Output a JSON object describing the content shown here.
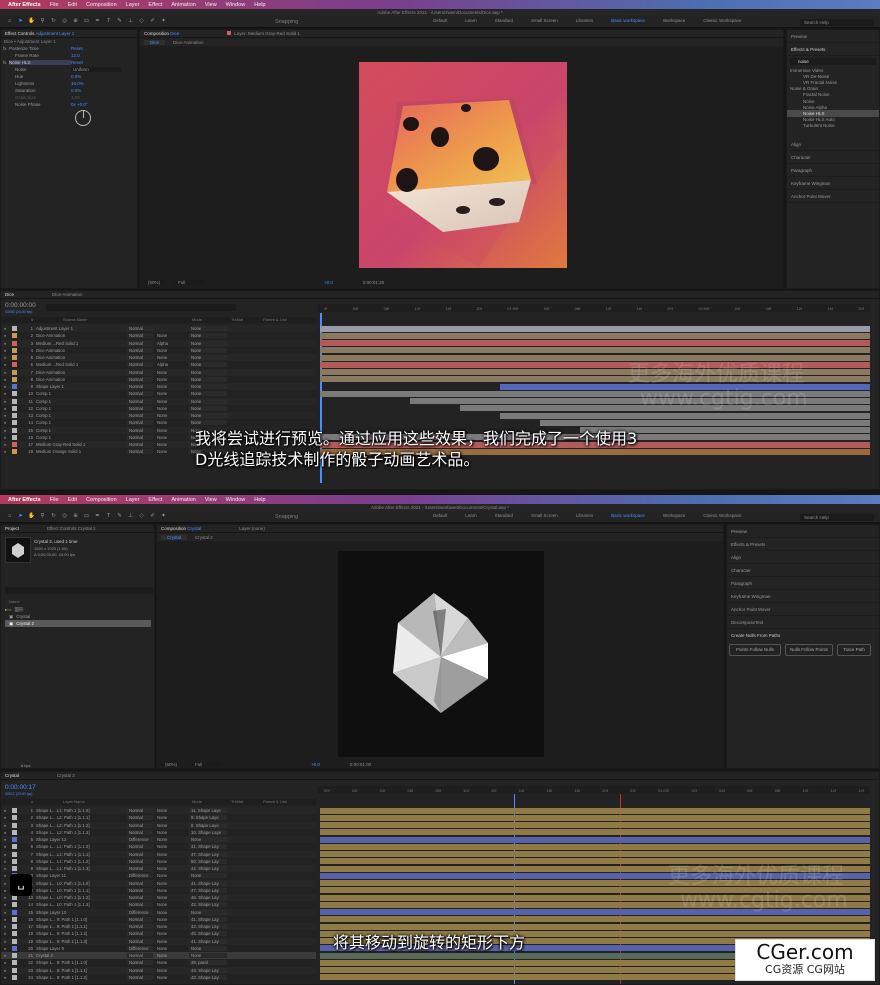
{
  "top": {
    "menu": {
      "app": "After Effects",
      "items": [
        "File",
        "Edit",
        "Composition",
        "Layer",
        "Effect",
        "Animation",
        "View",
        "Window",
        "Help"
      ]
    },
    "window_title": "Adobe After Effects 2021 - /Users/zwein/Documents/Dice.aep *",
    "snapping": "Snapping",
    "workspaces": [
      "Default",
      "Learn",
      "Standard",
      "Small Screen",
      "Libraries",
      "Basic workspace",
      "Workspace",
      "Classic Workspace"
    ],
    "search_placeholder": "Search Help",
    "effect_controls": {
      "tab": "Effect Controls",
      "tab_layer": "Adjustment Layer 1",
      "header": "Dice • Adjustment Layer 1",
      "props": [
        {
          "name": "Posterize Time",
          "value": "Reset"
        },
        {
          "name": "Frame Rate",
          "value": "12.0"
        },
        {
          "name": "Noise HLS",
          "value": "Reset"
        },
        {
          "name": "Noise",
          "value": "Uniform"
        },
        {
          "name": "Hue",
          "value": "0.0%"
        },
        {
          "name": "Lightness",
          "value": "10.0%"
        },
        {
          "name": "Saturation",
          "value": "0.0%"
        },
        {
          "name": "Grain Size",
          "value": "1.00"
        },
        {
          "name": "Noise Phase",
          "value": "0x +0.0°"
        }
      ]
    },
    "comp_panel": {
      "tab": "Composition",
      "tab_comp": "Dice",
      "layer_tab": "Layer: Medium Gray-Red Solid 1",
      "crumbs": [
        "Dice",
        "Dice-Animation"
      ],
      "zoom": "(50%)",
      "quality": "Full",
      "timecode": "0:00:01:20",
      "exposure": "+0.0"
    },
    "right_panel": {
      "preview": "Preview",
      "effects_presets": "Effects & Presets",
      "search_value": "noise",
      "tree": [
        {
          "label": "Immersive Video",
          "indent": 0
        },
        {
          "label": "VR De-Noise",
          "indent": 1
        },
        {
          "label": "VR Fractal Noise",
          "indent": 1
        },
        {
          "label": "Noise & Grain",
          "indent": 0
        },
        {
          "label": "Fractal Noise",
          "indent": 1
        },
        {
          "label": "Noise",
          "indent": 1
        },
        {
          "label": "Noise Alpha",
          "indent": 1
        },
        {
          "label": "Noise HLS",
          "indent": 1,
          "selected": true
        },
        {
          "label": "Noise HLS Auto",
          "indent": 1
        },
        {
          "label": "Turbulent Noise",
          "indent": 1
        }
      ],
      "panels": [
        "Align",
        "Character",
        "Paragraph",
        "Keyframe Wingman",
        "Anchor Point Mover"
      ]
    },
    "timeline": {
      "tabs": [
        "Dice",
        "Dice-Animation"
      ],
      "timecode": "0:00:00:00",
      "fps": "00000 (24.00 fps)",
      "headers": [
        "#",
        "Source Name",
        "Mode",
        "TrkMat",
        "Parent & Link"
      ],
      "ruler": [
        "0f",
        "04f",
        "08f",
        "12f",
        "16f",
        "20f",
        "01:00f",
        "04f",
        "08f",
        "12f",
        "16f",
        "20f",
        "02:00f",
        "04f",
        "08f",
        "12f",
        "16f",
        "20f"
      ],
      "layers": [
        {
          "num": "1",
          "name": "Adjustment Layer 1",
          "color": "#b6b6b6",
          "mode": "Normal",
          "trk": "",
          "parent": "None"
        },
        {
          "num": "2",
          "name": "Dice-Animation",
          "color": "#c59a5a",
          "mode": "Normal",
          "trk": "None",
          "parent": "None"
        },
        {
          "num": "3",
          "name": "Medium ...Red Solid 1",
          "color": "#d06060",
          "mode": "Normal",
          "trk": "Alpha",
          "parent": "None"
        },
        {
          "num": "4",
          "name": "Dice-Animation",
          "color": "#c59a5a",
          "mode": "Normal",
          "trk": "None",
          "parent": "None"
        },
        {
          "num": "5",
          "name": "Dice-Animation",
          "color": "#c59a5a",
          "mode": "Normal",
          "trk": "None",
          "parent": "None"
        },
        {
          "num": "6",
          "name": "Medium ...Red Solid 1",
          "color": "#d06060",
          "mode": "Normal",
          "trk": "Alpha",
          "parent": "None"
        },
        {
          "num": "7",
          "name": "Dice-Animation",
          "color": "#c59a5a",
          "mode": "Normal",
          "trk": "None",
          "parent": "None"
        },
        {
          "num": "8",
          "name": "Dice-Animation",
          "color": "#c59a5a",
          "mode": "Normal",
          "trk": "None",
          "parent": "None"
        },
        {
          "num": "9",
          "name": "Shape Layer 1",
          "color": "#5b6fd6",
          "mode": "Normal",
          "trk": "None",
          "parent": "None"
        },
        {
          "num": "10",
          "name": "Comp 1",
          "color": "#b6b6b6",
          "mode": "Normal",
          "trk": "None",
          "parent": "None"
        },
        {
          "num": "11",
          "name": "Comp 1",
          "color": "#b6b6b6",
          "mode": "Normal",
          "trk": "None",
          "parent": "None"
        },
        {
          "num": "12",
          "name": "Comp 1",
          "color": "#b6b6b6",
          "mode": "Normal",
          "trk": "None",
          "parent": "None"
        },
        {
          "num": "13",
          "name": "Comp 1",
          "color": "#b6b6b6",
          "mode": "Normal",
          "trk": "None",
          "parent": "None"
        },
        {
          "num": "14",
          "name": "Comp 1",
          "color": "#b6b6b6",
          "mode": "Normal",
          "trk": "None",
          "parent": "None"
        },
        {
          "num": "15",
          "name": "Comp 1",
          "color": "#b6b6b6",
          "mode": "Normal",
          "trk": "None",
          "parent": "None"
        },
        {
          "num": "16",
          "name": "Comp 1",
          "color": "#b6b6b6",
          "mode": "Normal",
          "trk": "None",
          "parent": "None"
        },
        {
          "num": "17",
          "name": "Medium Gray-Red Solid 1",
          "color": "#d06060",
          "mode": "Normal",
          "trk": "None",
          "parent": "None"
        },
        {
          "num": "18",
          "name": "Medium Orange Solid 1",
          "color": "#d4924a",
          "mode": "Normal",
          "trk": "None",
          "parent": "None"
        }
      ]
    },
    "subtitle_lines": [
      "我将尝试进行预览。通过应用这些效果，我们完成了一个使用3",
      "D光线追踪技术制作的骰子动画艺术品。"
    ]
  },
  "bottom": {
    "menu": {
      "app": "After Effects",
      "items": [
        "File",
        "Edit",
        "Composition",
        "Layer",
        "Effect",
        "Animation",
        "View",
        "Window",
        "Help"
      ]
    },
    "window_title": "Adobe After Effects 2021 - /Users/wenbwen/Documents/Crystal.aep *",
    "snapping": "Snapping",
    "workspaces": [
      "Default",
      "Learn",
      "Standard",
      "Small Screen",
      "Libraries",
      "Basic workspace",
      "Workspace",
      "Classic Workspace"
    ],
    "search_placeholder": "Search Help",
    "project": {
      "tab": "Project",
      "ec_tab": "Effect Controls Crystal 2",
      "item_name": "Crystal 2",
      "item_used": ", used 1 time",
      "info": [
        "1920 x 1920 (1.00)",
        "Δ 0;00;03;00, 24.00 fps"
      ],
      "col_name": "Name",
      "items": [
        {
          "label": "図形",
          "folder": true
        },
        {
          "label": "Crystal",
          "folder": false
        },
        {
          "label": "Crystal 2",
          "folder": false,
          "selected": true
        }
      ],
      "bpc": "8 bpc"
    },
    "comp_panel": {
      "tab": "Composition",
      "tab_comp": "Crystal",
      "layer_tab": "Layer (none)",
      "crumbs": [
        "Crystal",
        "Crystal 2"
      ],
      "zoom": "(50%)",
      "quality": "Full",
      "timecode": "0:00:01:00",
      "exposure": "+0.0"
    },
    "right_panel": {
      "panels": [
        "Preview",
        "Effects & Presets",
        "Align",
        "Character",
        "Paragraph",
        "Keyframe Wingman",
        "Anchor Point Mover",
        "DecomposeText"
      ],
      "nulls_title": "Create Nulls From Paths",
      "buttons": [
        "Points Follow Nulls",
        "Nulls Follow Points",
        "Trace Path"
      ]
    },
    "timeline": {
      "tabs": [
        "Crystal",
        "Crystal 2"
      ],
      "timecode": "0:00:00:17",
      "fps": "00017 (24.00 fps)",
      "headers": [
        "#",
        "Layer Name",
        "Mode",
        "TrkMat",
        "Parent & Link"
      ],
      "ruler": [
        "00f",
        "02f",
        "04f",
        "06f",
        "08f",
        "10f",
        "12f",
        "14f",
        "16f",
        "18f",
        "20f",
        "22f",
        "01:00f",
        "02f",
        "04f",
        "06f",
        "08f",
        "10f",
        "12f",
        "14f"
      ],
      "layers": [
        {
          "num": "1",
          "name": "Shape L... L1: Path 1 [1.1.0]",
          "color": "#b6b6b6",
          "mode": "Normal",
          "trk": "None",
          "parent": "11. Shape Laye"
        },
        {
          "num": "2",
          "name": "Shape L... L2: Path 1 [1.1.1]",
          "color": "#b6b6b6",
          "mode": "Normal",
          "trk": "None",
          "parent": "9. Shape Laye"
        },
        {
          "num": "3",
          "name": "Shape L... L2: Path 1 [1.1.2]",
          "color": "#b6b6b6",
          "mode": "Normal",
          "trk": "None",
          "parent": "8. Shape Laye"
        },
        {
          "num": "4",
          "name": "Shape L... L2: Path 1 [1.1.3]",
          "color": "#b6b6b6",
          "mode": "Normal",
          "trk": "None",
          "parent": "10. Shape Laye"
        },
        {
          "num": "5",
          "name": "Shape Layer 12",
          "color": "#5b6fd6",
          "mode": "Difference",
          "trk": "None",
          "parent": "None"
        },
        {
          "num": "6",
          "name": "Shape L... L1: Path 1 [1.1.0]",
          "color": "#b6b6b6",
          "mode": "Normal",
          "trk": "None",
          "parent": "41. Shape Lay"
        },
        {
          "num": "7",
          "name": "Shape L... L1: Path 1 [1.1.1]",
          "color": "#b6b6b6",
          "mode": "Normal",
          "trk": "None",
          "parent": "47. Shape Lay"
        },
        {
          "num": "8",
          "name": "Shape L... L1: Path 1 [1.1.2]",
          "color": "#b6b6b6",
          "mode": "Normal",
          "trk": "None",
          "parent": "50. Shape Lay"
        },
        {
          "num": "9",
          "name": "Shape L... L1: Path 1 [1.1.3]",
          "color": "#b6b6b6",
          "mode": "Normal",
          "trk": "None",
          "parent": "44. Shape Lay"
        },
        {
          "num": "10",
          "name": "Shape Layer 11",
          "color": "#5b6fd6",
          "mode": "Difference",
          "trk": "None",
          "parent": "None"
        },
        {
          "num": "11",
          "name": "Shape L... L0: Path 1 [1.1.0]",
          "color": "#b6b6b6",
          "mode": "Normal",
          "trk": "None",
          "parent": "41. Shape Lay"
        },
        {
          "num": "12",
          "name": "Shape L... L0: Path 1 [1.1.1]",
          "color": "#b6b6b6",
          "mode": "Normal",
          "trk": "None",
          "parent": "47. Shape Lay"
        },
        {
          "num": "13",
          "name": "Shape L... L0: Path 1 [1.1.2]",
          "color": "#b6b6b6",
          "mode": "Normal",
          "trk": "None",
          "parent": "46. Shape Lay"
        },
        {
          "num": "14",
          "name": "Shape L... L0: Path 1 [1.1.3]",
          "color": "#b6b6b6",
          "mode": "Normal",
          "trk": "None",
          "parent": "42. Shape Lay"
        },
        {
          "num": "15",
          "name": "Shape Layer 10",
          "color": "#5b6fd6",
          "mode": "Difference",
          "trk": "None",
          "parent": "None"
        },
        {
          "num": "16",
          "name": "Shape L... 9: Path 1 [1.1.0]",
          "color": "#b6b6b6",
          "mode": "Normal",
          "trk": "None",
          "parent": "41. Shape Lay"
        },
        {
          "num": "17",
          "name": "Shape L... 9: Path 1 [1.1.1]",
          "color": "#b6b6b6",
          "mode": "Normal",
          "trk": "None",
          "parent": "42. Shape Lay"
        },
        {
          "num": "18",
          "name": "Shape L... 9: Path 1 [1.1.2]",
          "color": "#b6b6b6",
          "mode": "Normal",
          "trk": "None",
          "parent": "45. Shape Lay"
        },
        {
          "num": "19",
          "name": "Shape L... 9: Path 1 [1.1.3]",
          "color": "#b6b6b6",
          "mode": "Normal",
          "trk": "None",
          "parent": "41. Shape Lay"
        },
        {
          "num": "20",
          "name": "Shape Layer 9",
          "color": "#5b6fd6",
          "mode": "Difference",
          "trk": "None",
          "parent": "None"
        },
        {
          "num": "21",
          "name": "Crystal 2",
          "color": "#b6b6b6",
          "mode": "Normal",
          "trk": "None",
          "parent": "None"
        },
        {
          "num": "22",
          "name": "Shape L... 8: Path 1 [1.1.0]",
          "color": "#b6b6b6",
          "mode": "Normal",
          "trk": "None",
          "parent": "39. paral"
        },
        {
          "num": "23",
          "name": "Shape L... 8: Path 1 [1.1.1]",
          "color": "#b6b6b6",
          "mode": "Normal",
          "trk": "None",
          "parent": "44. Shape Lay"
        },
        {
          "num": "24",
          "name": "Shape L... 8: Path 1 [1.1.2]",
          "color": "#b6b6b6",
          "mode": "Normal",
          "trk": "None",
          "parent": "43. Shape Lay"
        }
      ]
    },
    "subtitle": "将其移动到旋转的矩形下方"
  },
  "watermark": {
    "cn": "更多海外优质课程",
    "url": "www.cgtig.com"
  },
  "logo": {
    "title": "CGer.com",
    "subtitle": "CG资源 CG网站"
  }
}
